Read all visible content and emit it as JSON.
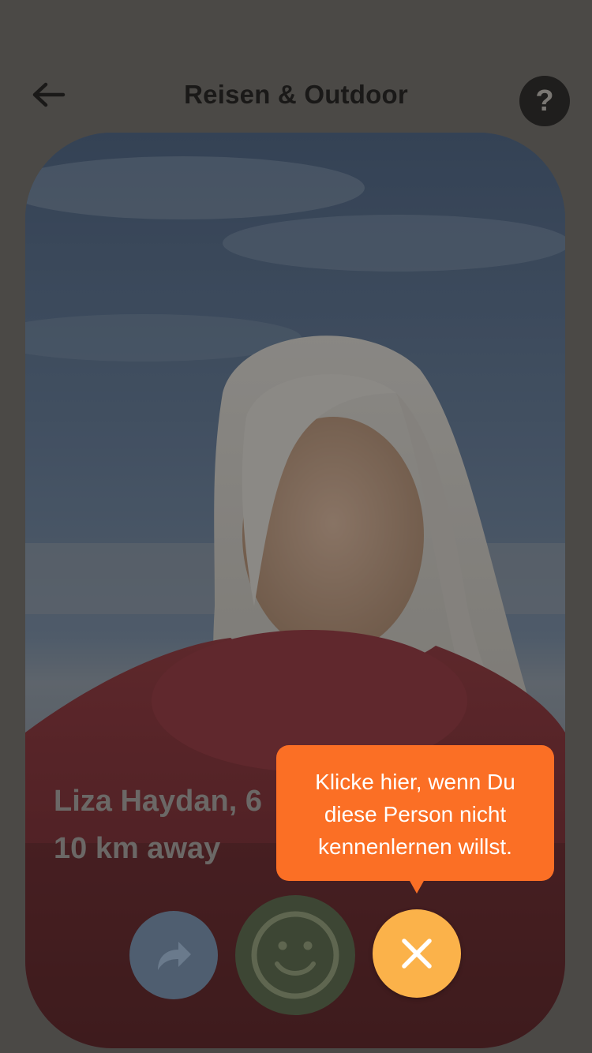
{
  "header": {
    "title": "Reisen & Outdoor",
    "back_icon": "arrow-left-icon",
    "help_label": "?"
  },
  "profile": {
    "name_age": "Liza Haydan, 6",
    "distance": "10 km away"
  },
  "actions": {
    "share_icon": "share-arrow-icon",
    "like_icon": "smiley-icon",
    "reject_icon": "close-x-icon"
  },
  "tooltip": {
    "lines": [
      "Klicke hier, wenn Du",
      "diese Person nicht",
      "kennenlernen willst."
    ]
  },
  "colors": {
    "overlay_bg": "#4b4946",
    "tooltip_bg": "#fb6f25",
    "reject_button": "#fbb24a",
    "help_button": "#1f1e1d"
  }
}
